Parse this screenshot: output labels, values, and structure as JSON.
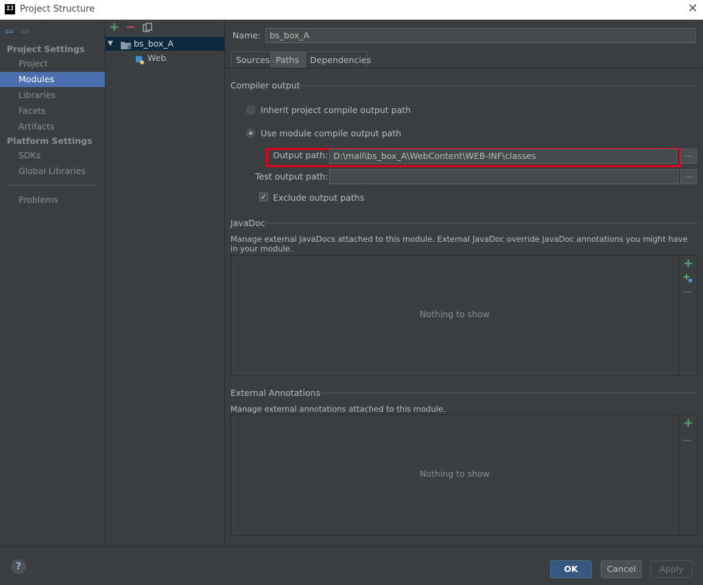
{
  "window": {
    "title": "Project Structure",
    "logo_text": "IJ"
  },
  "sidebar": {
    "back_icon": "arrow-left-icon",
    "forward_icon": "arrow-right-icon",
    "project_settings_header": "Project Settings",
    "project_items": [
      "Project",
      "Modules",
      "Libraries",
      "Facets",
      "Artifacts"
    ],
    "selected": "Modules",
    "platform_settings_header": "Platform Settings",
    "platform_items": [
      "SDKs",
      "Global Libraries"
    ],
    "problems": "Problems"
  },
  "tree": {
    "root": "bs_box_A",
    "child": "Web"
  },
  "module": {
    "name_label": "Name:",
    "name_value": "bs_box_A",
    "tabs": [
      "Sources",
      "Paths",
      "Dependencies"
    ],
    "active_tab": "Paths"
  },
  "compiler": {
    "title": "Compiler output",
    "inherit_label": "Inherit project compile output path",
    "use_module_label": "Use module compile output path",
    "output_label": "Output path:",
    "output_value": "D:\\mall\\bs_box_A\\WebContent\\WEB-INF\\classes",
    "test_label": "Test output path:",
    "test_value": "",
    "exclude_label": "Exclude output paths",
    "browse_label": "..."
  },
  "javadoc": {
    "title": "JavaDoc",
    "description": "Manage external JavaDocs attached to this module. External JavaDoc override JavaDoc annotations you might have in your module.",
    "empty": "Nothing to show"
  },
  "annotations": {
    "title": "External Annotations",
    "description": "Manage external annotations attached to this module.",
    "empty": "Nothing to show"
  },
  "footer": {
    "help": "?",
    "ok": "OK",
    "cancel": "Cancel",
    "apply": "Apply"
  },
  "colors": {
    "background": "#3c3f41",
    "selection": "#4b6eaf",
    "highlight": "#e0001b",
    "ok_button": "#365880"
  }
}
